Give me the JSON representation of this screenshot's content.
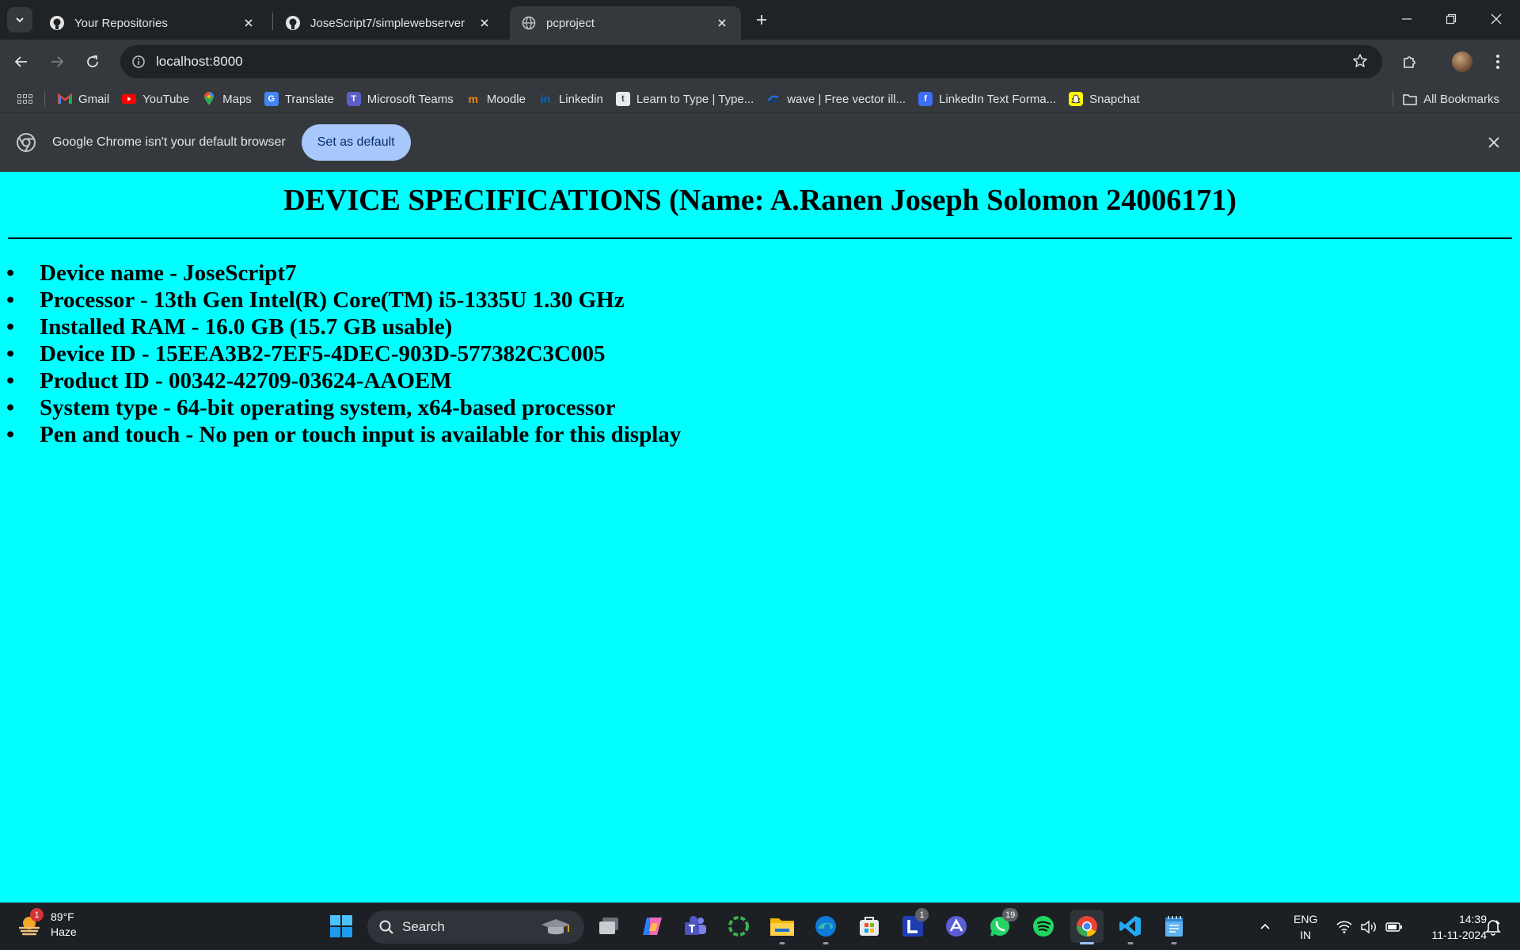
{
  "browser": {
    "tabs": [
      {
        "title": "Your Repositories",
        "icon": "github-icon"
      },
      {
        "title": "JoseScript7/simplewebserver",
        "icon": "github-icon"
      },
      {
        "title": "pcproject",
        "icon": "globe-icon",
        "active": true
      }
    ],
    "url": "localhost:8000",
    "bookmarks": [
      {
        "label": "Gmail",
        "icon": "gmail-icon"
      },
      {
        "label": "YouTube",
        "icon": "youtube-icon"
      },
      {
        "label": "Maps",
        "icon": "maps-icon"
      },
      {
        "label": "Translate",
        "icon": "translate-icon"
      },
      {
        "label": "Microsoft Teams",
        "icon": "teams-icon"
      },
      {
        "label": "Moodle",
        "icon": "moodle-icon"
      },
      {
        "label": "Linkedin",
        "icon": "linkedin-icon"
      },
      {
        "label": "Learn to Type | Type...",
        "icon": "typing-icon"
      },
      {
        "label": "wave | Free vector ill...",
        "icon": "wave-icon"
      },
      {
        "label": "LinkedIn Text Forma...",
        "icon": "text-format-icon"
      },
      {
        "label": "Snapchat",
        "icon": "snapchat-icon"
      }
    ],
    "all_bookmarks": "All Bookmarks",
    "infobar": {
      "message": "Google Chrome isn't your default browser",
      "button": "Set as default"
    }
  },
  "page": {
    "heading": "DEVICE SPECIFICATIONS (Name: A.Ranen Joseph Solomon 24006171)",
    "specs": [
      "Device name - JoseScript7",
      "Processor - 13th Gen Intel(R) Core(TM) i5-1335U 1.30 GHz",
      "Installed RAM - 16.0 GB (15.7 GB usable)",
      "Device ID - 15EEA3B2-7EF5-4DEC-903D-577382C3C005",
      "Product ID - 00342-42709-03624-AAOEM",
      "System type - 64-bit operating system, x64-based processor",
      "Pen and touch - No pen or touch input is available for this display"
    ],
    "background": "#00ffff"
  },
  "taskbar": {
    "weather": {
      "temp": "89°F",
      "condition": "Haze",
      "badge": "1"
    },
    "search_placeholder": "Search",
    "badges": {
      "outlook": "1",
      "whatsapp": "19"
    },
    "language": {
      "line1": "ENG",
      "line2": "IN"
    },
    "time": "14:39",
    "date": "11-11-2024"
  }
}
